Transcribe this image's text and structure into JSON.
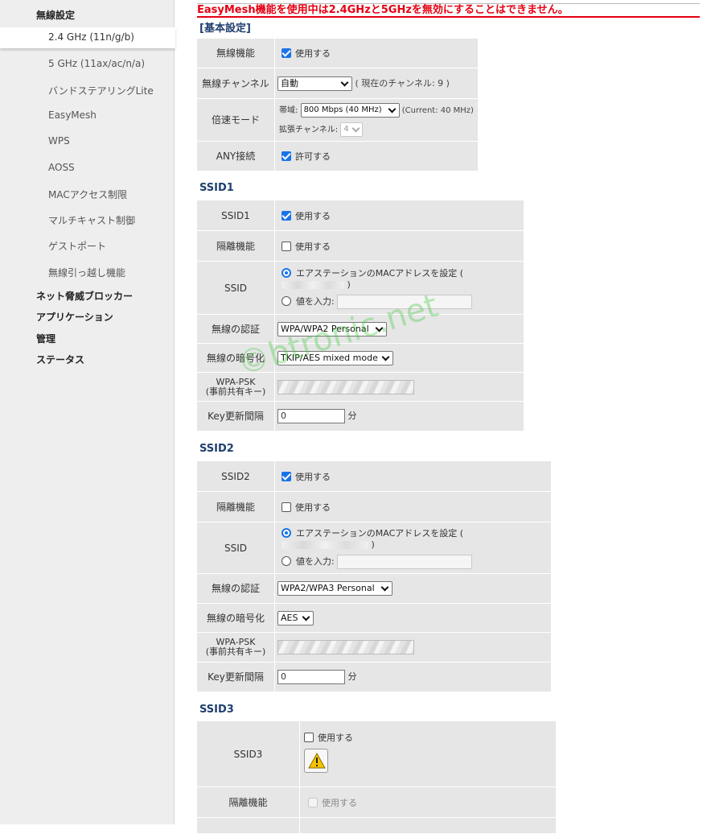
{
  "sidebar": {
    "wireless_settings": "無線設定",
    "items": [
      "2.4 GHz (11n/g/b)",
      "5 GHz (11ax/ac/n/a)",
      "バンドステアリングLite",
      "EasyMesh",
      "WPS",
      "AOSS",
      "MACアクセス制限",
      "マルチキャスト制御",
      "ゲストポート",
      "無線引っ越し機能"
    ],
    "sections": [
      "ネット脅威ブロッカー",
      "アプリケーション",
      "管理",
      "ステータス"
    ]
  },
  "warning": "EasyMesh機能を使用中は2.4GHzと5GHzを無効にすることはできません。",
  "basic": {
    "title": "[基本設定]",
    "wireless_label": "無線機能",
    "wireless_check": "使用する",
    "channel_label": "無線チャンネル",
    "channel_value": "自動",
    "channel_current": "( 現在のチャンネル: 9 )",
    "speed_label": "倍速モード",
    "bandwidth_label": "帯域:",
    "bandwidth_value": "800 Mbps (40 MHz)",
    "bandwidth_current": "(Current: 40 MHz)",
    "ext_channel_label": "拡張チャンネル:",
    "ext_channel_value": "4",
    "any_label": "ANY接続",
    "any_check": "許可する"
  },
  "ssid1": {
    "title": "SSID1",
    "ssid_label": "SSID1",
    "ssid_check": "使用する",
    "isolate_label": "隔離機能",
    "isolate_check": "使用する",
    "ssid_name_label": "SSID",
    "radio_mac": "エアステーションのMACアドレスを設定 (",
    "radio_mac_close": ")",
    "radio_input": "値を入力:",
    "auth_label": "無線の認証",
    "auth_value": "WPA/WPA2 Personal",
    "enc_label": "無線の暗号化",
    "enc_value": "TKIP/AES mixed mode",
    "psk_label_1": "WPA-PSK",
    "psk_label_2": "(事前共有キー)",
    "key_label": "Key更新間隔",
    "key_value": "0",
    "key_unit": "分"
  },
  "ssid2": {
    "title": "SSID2",
    "ssid_label": "SSID2",
    "ssid_check": "使用する",
    "isolate_label": "隔離機能",
    "isolate_check": "使用する",
    "ssid_name_label": "SSID",
    "radio_mac": "エアステーションのMACアドレスを設定 (",
    "radio_mac_close": ")",
    "radio_input": "値を入力:",
    "auth_label": "無線の認証",
    "auth_value": "WPA2/WPA3 Personal",
    "enc_label": "無線の暗号化",
    "enc_value": "AES",
    "psk_label_1": "WPA-PSK",
    "psk_label_2": "(事前共有キー)",
    "key_label": "Key更新間隔",
    "key_value": "0",
    "key_unit": "分"
  },
  "ssid3": {
    "title": "SSID3",
    "ssid_label": "SSID3",
    "ssid_check": "使用する",
    "isolate_label": "隔離機能",
    "isolate_check": "使用する"
  },
  "watermark": "©btronic.net",
  "colors": {
    "accent": "#1a73e8",
    "warning": "#e60012",
    "section_title": "#1f3f6e"
  }
}
